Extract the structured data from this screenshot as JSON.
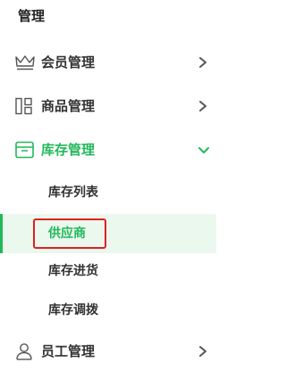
{
  "section_title": "管理",
  "menu": {
    "members": {
      "label": "会员管理",
      "icon": "crown-icon"
    },
    "products": {
      "label": "商品管理",
      "icon": "grid-icon"
    },
    "inventory": {
      "label": "库存管理",
      "icon": "box-icon",
      "expanded": true,
      "children": [
        {
          "label": "库存列表"
        },
        {
          "label": "供应商",
          "selected": true
        },
        {
          "label": "库存进货"
        },
        {
          "label": "库存调拨"
        }
      ]
    },
    "staff": {
      "label": "员工管理",
      "icon": "user-icon"
    }
  },
  "colors": {
    "accent": "#22b85a",
    "selected_bg": "#eaf8ee",
    "highlight_border": "#e02020"
  }
}
